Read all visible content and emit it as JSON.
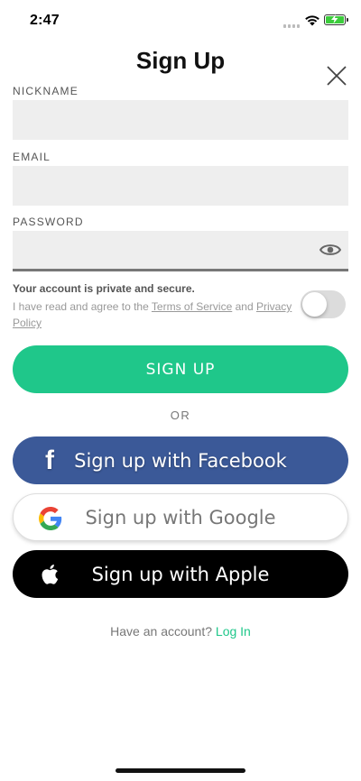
{
  "status_bar": {
    "time": "2:47"
  },
  "header": {
    "title": "Sign Up"
  },
  "form": {
    "nickname_label": "NICKNAME",
    "email_label": "EMAIL",
    "password_label": "PASSWORD",
    "nickname_value": "",
    "email_value": "",
    "password_value": ""
  },
  "privacy": {
    "secure_text": "Your account is private and secure.",
    "agree_prefix": "I have read and agree to the ",
    "terms_link": "Terms of Service",
    "and_text": " and ",
    "privacy_link": "Privacy Policy",
    "toggle_on": false
  },
  "buttons": {
    "signup": "SIGN UP",
    "or": "OR",
    "facebook": "Sign up with Facebook",
    "google": "Sign up with Google",
    "apple": "Sign up with Apple"
  },
  "footer": {
    "have_account": "Have an account? ",
    "login": "Log In"
  },
  "colors": {
    "accent": "#1fc78a",
    "facebook": "#3b5998",
    "apple": "#000000",
    "field_bg": "#eeeeee"
  },
  "icons": [
    "wifi-icon",
    "battery-icon",
    "close-icon",
    "eye-icon",
    "facebook-icon",
    "google-icon",
    "apple-icon"
  ]
}
